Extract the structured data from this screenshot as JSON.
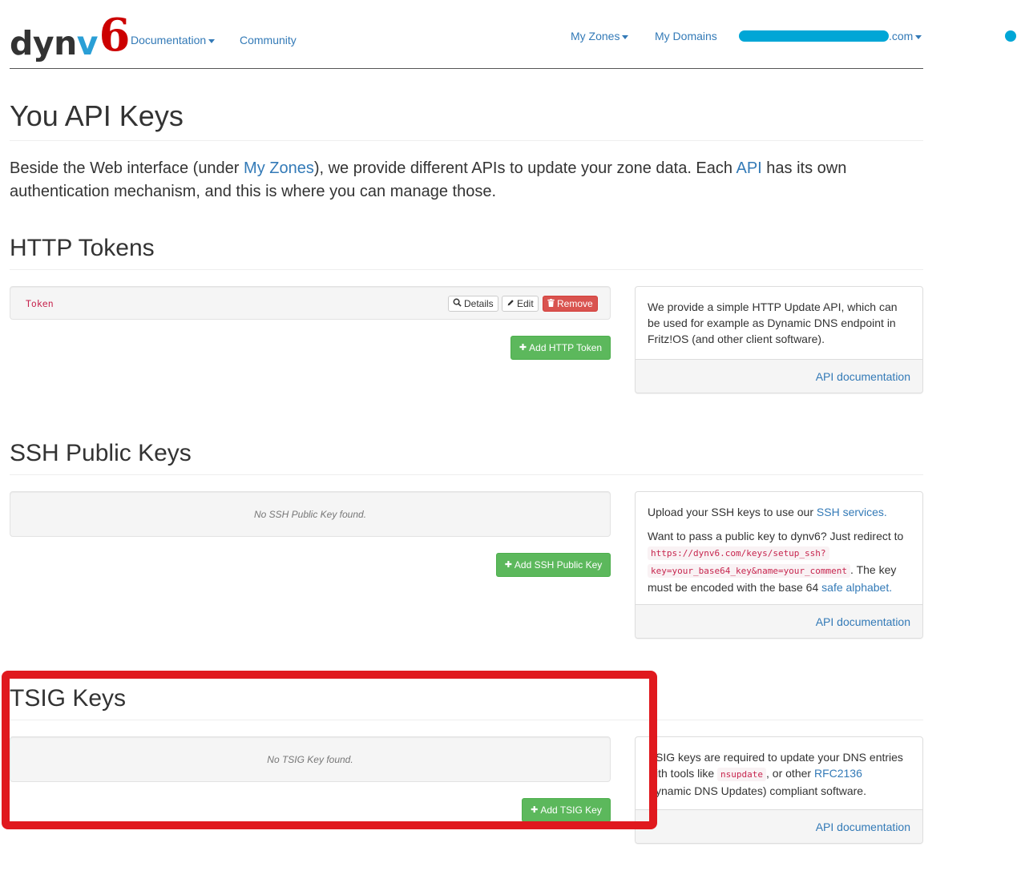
{
  "navbar": {
    "brand": {
      "part1": "dyn",
      "part2": "v",
      "part3": "6"
    },
    "left_links": [
      {
        "label": "Documentation",
        "dropdown": true
      },
      {
        "label": "Community",
        "dropdown": false
      }
    ],
    "right_links": [
      {
        "label": "My Zones",
        "dropdown": true
      },
      {
        "label": "My Domains",
        "dropdown": false
      }
    ],
    "account": {
      "suffix": ".com",
      "redacted": true
    }
  },
  "page": {
    "title": "You API Keys",
    "intro": {
      "part1": "Beside the Web interface (under ",
      "link1": "My Zones",
      "part2": "), we provide different APIs to update your zone data. Each ",
      "link2": "API",
      "part3": " has its own authentication mechanism, and this is where you can manage those."
    }
  },
  "http_tokens": {
    "heading": "HTTP Tokens",
    "items": [
      {
        "name": "Token",
        "actions": {
          "details": "Details",
          "edit": "Edit",
          "remove": "Remove"
        }
      }
    ],
    "add_button": "Add HTTP Token",
    "info": {
      "text": "We provide a simple HTTP Update API, which can be used for example as Dynamic DNS endpoint in Fritz!OS (and other client software).",
      "footer_link": "API documentation"
    }
  },
  "ssh_keys": {
    "heading": "SSH Public Keys",
    "empty_text": "No SSH Public Key found.",
    "add_button": "Add SSH Public Key",
    "info": {
      "p1_text": "Upload your SSH keys to use our ",
      "p1_link": "SSH services",
      "p1_end": ".",
      "p2_text": "Want to pass a public key to dynv6? Just redirect to",
      "code_line1": "https://dynv6.com/keys/setup_ssh?",
      "code_line2": "key=your_base64_key&name=your_comment",
      "p2_after_code": ". The key must be encoded with the base 64 ",
      "p2_link": "safe alphabet",
      "p2_end": ".",
      "footer_link": "API documentation"
    }
  },
  "tsig_keys": {
    "heading": "TSIG Keys",
    "empty_text": "No TSIG Key found.",
    "add_button": "Add TSIG Key",
    "info": {
      "line1": "SIG keys are required to update your DNS entries",
      "line2_pre": "ith tools like ",
      "code": "nsupdate",
      "line2_mid": ", or other ",
      "link": "RFC2136",
      "line3": "ynamic DNS Updates) compliant software.",
      "footer_link": "API documentation"
    }
  },
  "colors": {
    "link": "#337ab7",
    "success": "#5cb85c",
    "danger": "#d9534f",
    "highlight": "#e0191e",
    "redaction": "#00a6d6",
    "brand_red": "#cc0000",
    "brand_blue": "#2a9fd6"
  },
  "icons": {
    "details": "search-icon",
    "edit": "pencil-icon",
    "remove": "trash-icon",
    "add": "plus-icon",
    "dropdown": "caret-down-icon"
  }
}
